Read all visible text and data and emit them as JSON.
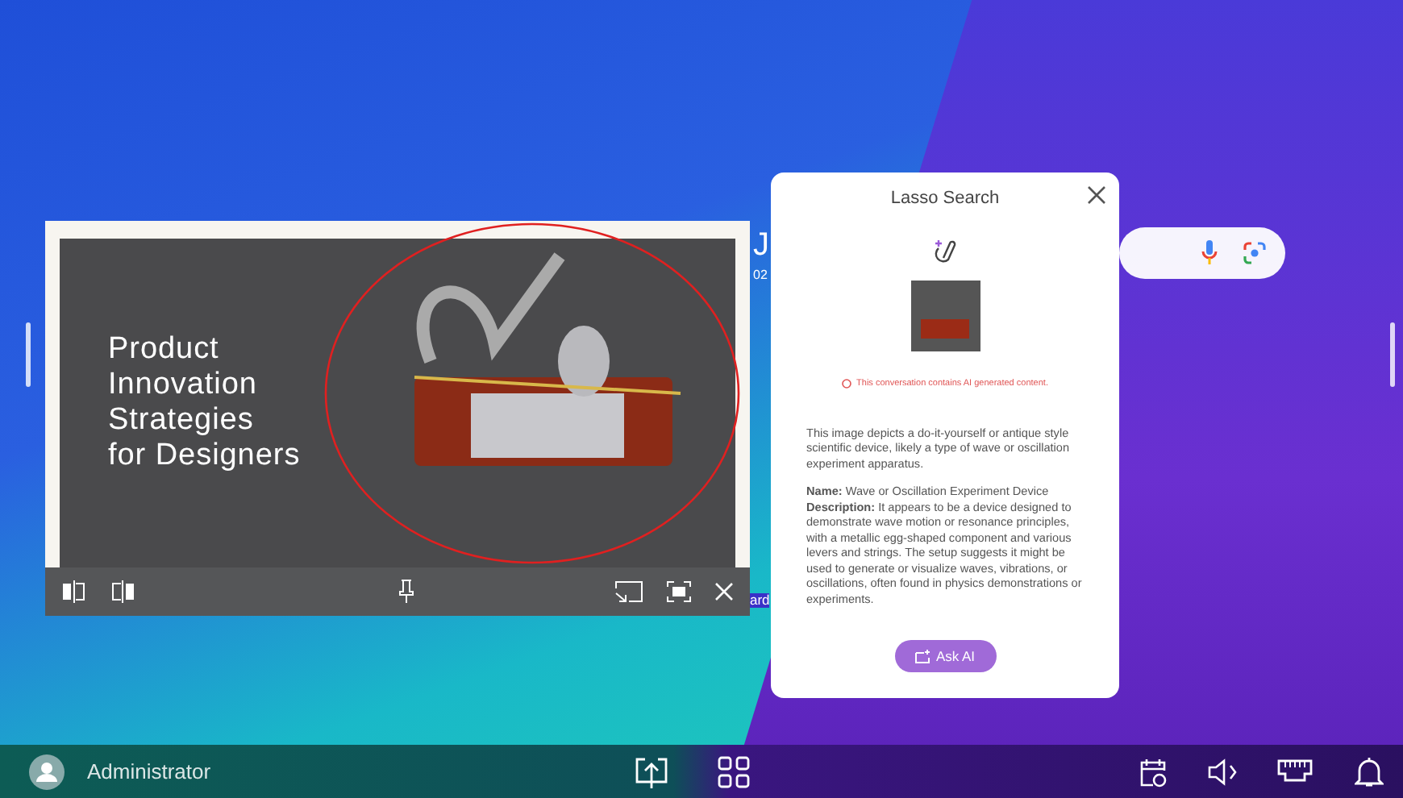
{
  "desktop": {
    "partial_texts": [
      "J",
      "02",
      "ard"
    ]
  },
  "slide_window": {
    "slide_title": [
      "Product",
      "Innovation",
      "Strategies",
      "for Designers"
    ]
  },
  "lasso_panel": {
    "title": "Lasso Search",
    "notice": "This conversation contains AI generated content.",
    "summary": "This image depicts a do-it-yourself or antique style scientific device, likely a type of wave or oscillation experiment apparatus.",
    "details": [
      "**Name:** Wave or Oscillation Experiment Device",
      "**Description:** It appears to be a device designed to demonstrate wave motion or resonance principles, with a metallic egg-shaped component and various levers and strings. The setup suggests it might be used to generate or visualize waves, vibrations, or oscillations, often found in physics demonstrations or experiments."
    ],
    "button": "Ask AI"
  },
  "taskbar": {
    "user": "Administrator"
  }
}
